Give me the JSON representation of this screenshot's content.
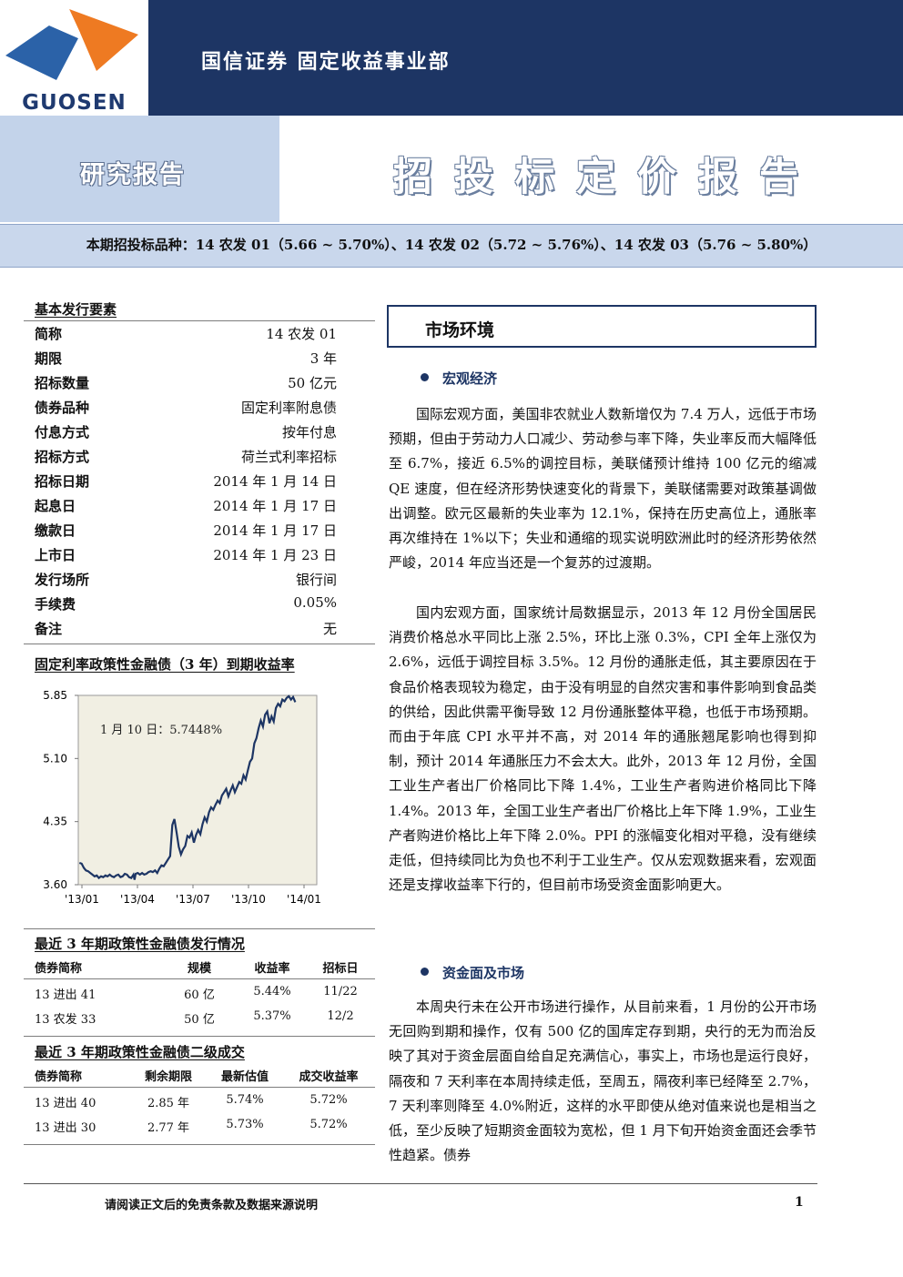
{
  "header": {
    "logo_text": "GUOSEN",
    "company": "国信证券  固定收益事业部",
    "report_type": "研究报告",
    "title": "招投标定价报告",
    "variety": "本期招投标品种：14 农发 01（5.66 ~ 5.70%）、14 农发 02（5.72 ~ 5.76%）、14 农发 03（5.76 ~ 5.80%）",
    "colors": {
      "navy": "#1d3564",
      "light_blue": "#c3d3ea",
      "logo_blue": "#2b62a8",
      "logo_orange": "#ee7a22"
    }
  },
  "basic": {
    "title": "基本发行要素",
    "rows": [
      {
        "key": "简称",
        "value": "14 农发 01"
      },
      {
        "key": "期限",
        "value": "3 年"
      },
      {
        "key": "招标数量",
        "value": "50 亿元"
      },
      {
        "key": "债券品种",
        "value": "固定利率附息债"
      },
      {
        "key": "付息方式",
        "value": "按年付息"
      },
      {
        "key": "招标方式",
        "value": "荷兰式利率招标"
      },
      {
        "key": "招标日期",
        "value": "2014 年 1 月 14 日"
      },
      {
        "key": "起息日",
        "value": "2014 年 1 月 17 日"
      },
      {
        "key": "缴款日",
        "value": "2014 年 1 月 17 日"
      },
      {
        "key": "上市日",
        "value": "2014 年 1 月 23 日"
      },
      {
        "key": "发行场所",
        "value": "银行间"
      },
      {
        "key": "手续费",
        "value": "0.05%"
      },
      {
        "key": "备注",
        "value": "无"
      }
    ]
  },
  "chart_title": "固定利率政策性金融债（3 年）到期收益率",
  "chart_data": {
    "type": "line",
    "annotation": "1 月 10 日：5.7448%",
    "x_ticks": [
      "'13/01",
      "'13/04",
      "'13/07",
      "'13/10",
      "'14/01"
    ],
    "y_ticks": [
      "5.85",
      "5.10",
      "4.35",
      "3.60"
    ],
    "ylim": [
      3.6,
      5.85
    ],
    "grid": false,
    "series": [
      {
        "points": [
          [
            0.0,
            3.86
          ],
          [
            0.01,
            3.85
          ],
          [
            0.02,
            3.8
          ],
          [
            0.03,
            3.77
          ],
          [
            0.04,
            3.76
          ],
          [
            0.05,
            3.74
          ],
          [
            0.06,
            3.72
          ],
          [
            0.07,
            3.7
          ],
          [
            0.08,
            3.71
          ],
          [
            0.09,
            3.68
          ],
          [
            0.1,
            3.7
          ],
          [
            0.11,
            3.69
          ],
          [
            0.12,
            3.71
          ],
          [
            0.13,
            3.7
          ],
          [
            0.14,
            3.72
          ],
          [
            0.15,
            3.7
          ],
          [
            0.16,
            3.69
          ],
          [
            0.17,
            3.71
          ],
          [
            0.18,
            3.72
          ],
          [
            0.19,
            3.69
          ],
          [
            0.2,
            3.7
          ],
          [
            0.21,
            3.73
          ],
          [
            0.22,
            3.72
          ],
          [
            0.23,
            3.69
          ],
          [
            0.24,
            3.68
          ],
          [
            0.25,
            3.72
          ],
          [
            0.255,
            3.66
          ],
          [
            0.26,
            3.73
          ],
          [
            0.27,
            3.74
          ],
          [
            0.28,
            3.72
          ],
          [
            0.29,
            3.74
          ],
          [
            0.3,
            3.72
          ],
          [
            0.31,
            3.73
          ],
          [
            0.32,
            3.75
          ],
          [
            0.33,
            3.76
          ],
          [
            0.34,
            3.75
          ],
          [
            0.35,
            3.77
          ],
          [
            0.36,
            3.74
          ],
          [
            0.37,
            3.79
          ],
          [
            0.38,
            3.83
          ],
          [
            0.39,
            3.82
          ],
          [
            0.4,
            3.86
          ],
          [
            0.41,
            3.9
          ],
          [
            0.42,
            3.94
          ],
          [
            0.43,
            4.31
          ],
          [
            0.44,
            4.38
          ],
          [
            0.45,
            4.22
          ],
          [
            0.46,
            4.05
          ],
          [
            0.47,
            3.96
          ],
          [
            0.48,
            4.02
          ],
          [
            0.49,
            4.06
          ],
          [
            0.5,
            4.18
          ],
          [
            0.51,
            4.16
          ],
          [
            0.52,
            4.22
          ],
          [
            0.53,
            4.1
          ],
          [
            0.54,
            4.19
          ],
          [
            0.55,
            4.25
          ],
          [
            0.56,
            4.2
          ],
          [
            0.57,
            4.32
          ],
          [
            0.58,
            4.4
          ],
          [
            0.59,
            4.35
          ],
          [
            0.6,
            4.46
          ],
          [
            0.61,
            4.52
          ],
          [
            0.62,
            4.49
          ],
          [
            0.63,
            4.55
          ],
          [
            0.64,
            4.6
          ],
          [
            0.65,
            4.57
          ],
          [
            0.66,
            4.66
          ],
          [
            0.67,
            4.7
          ],
          [
            0.68,
            4.74
          ],
          [
            0.69,
            4.65
          ],
          [
            0.7,
            4.72
          ],
          [
            0.71,
            4.78
          ],
          [
            0.72,
            4.7
          ],
          [
            0.73,
            4.76
          ],
          [
            0.74,
            4.82
          ],
          [
            0.75,
            4.8
          ],
          [
            0.76,
            4.9
          ],
          [
            0.77,
            4.85
          ],
          [
            0.78,
            4.96
          ],
          [
            0.79,
            5.06
          ],
          [
            0.8,
            5.1
          ],
          [
            0.81,
            5.28
          ],
          [
            0.82,
            5.34
          ],
          [
            0.83,
            5.46
          ],
          [
            0.84,
            5.55
          ],
          [
            0.85,
            5.48
          ],
          [
            0.86,
            5.62
          ],
          [
            0.87,
            5.66
          ],
          [
            0.88,
            5.52
          ],
          [
            0.89,
            5.6
          ],
          [
            0.9,
            5.54
          ],
          [
            0.91,
            5.7
          ],
          [
            0.92,
            5.75
          ],
          [
            0.93,
            5.72
          ],
          [
            0.94,
            5.8
          ],
          [
            0.95,
            5.78
          ],
          [
            0.96,
            5.82
          ],
          [
            0.97,
            5.84
          ],
          [
            0.98,
            5.8
          ],
          [
            0.99,
            5.83
          ],
          [
            1.0,
            5.77
          ]
        ]
      }
    ],
    "colors": {
      "line": "#1d3564",
      "plot_bg": "#f1efe3"
    }
  },
  "issue_table": {
    "title": "最近 3 年期政策性金融债发行情况",
    "headers": [
      "债券简称",
      "规模",
      "收益率",
      "招标日"
    ],
    "rows": [
      [
        "13 进出 41",
        "60 亿",
        "5.44%",
        "11/22"
      ],
      [
        "13 农发 33",
        "50 亿",
        "5.37%",
        "12/2"
      ]
    ]
  },
  "secondary_table": {
    "title": "最近 3 年期政策性金融债二级成交",
    "headers": [
      "债券简称",
      "剩余期限",
      "最新估值",
      "成交收益率"
    ],
    "rows": [
      [
        "13 进出 40",
        "2.85 年",
        "5.74%",
        "5.72%"
      ],
      [
        "13 进出 30",
        "2.77 年",
        "5.73%",
        "5.72%"
      ]
    ]
  },
  "main": {
    "section_title": "市场环境",
    "macro_title": "宏观经济",
    "macro_p1": "国际宏观方面，美国非农就业人数新增仅为 7.4 万人，远低于市场预期，但由于劳动力人口减少、劳动参与率下降，失业率反而大幅降低至 6.7%，接近 6.5%的调控目标，美联储预计维持 100 亿元的缩减 QE 速度，但在经济形势快速变化的背景下，美联储需要对政策基调做出调整。欧元区最新的失业率为 12.1%，保持在历史高位上，通胀率再次维持在 1%以下；失业和通缩的现实说明欧洲此时的经济形势依然严峻，2014 年应当还是一个复苏的过渡期。",
    "macro_p2": "国内宏观方面，国家统计局数据显示，2013 年 12 月份全国居民消费价格总水平同比上涨 2.5%，环比上涨 0.3%，CPI 全年上涨仅为 2.6%，远低于调控目标 3.5%。12 月份的通胀走低，其主要原因在于食品价格表现较为稳定，由于没有明显的自然灾害和事件影响到食品类的供给，因此供需平衡导致 12 月份通胀整体平稳，也低于市场预期。而由于年底 CPI 水平并不高，对 2014 年的通胀翘尾影响也得到抑制，预计 2014 年通胀压力不会太大。此外，2013 年 12 月份，全国工业生产者出厂价格同比下降 1.4%，工业生产者购进价格同比下降 1.4%。2013 年，全国工业生产者出厂价格比上年下降 1.9%，工业生产者购进价格比上年下降 2.0%。PPI 的涨幅变化相对平稳，没有继续走低，但持续同比为负也不利于工业生产。仅从宏观数据来看，宏观面还是支撑收益率下行的，但目前市场受资金面影响更大。",
    "fund_title": "资金面及市场",
    "fund_p1": "本周央行未在公开市场进行操作，从目前来看，1 月份的公开市场无回购到期和操作，仅有 500 亿的国库定存到期，央行的无为而治反映了其对于资金层面自给自足充满信心，事实上，市场也是运行良好，隔夜和 7 天利率在本周持续走低，至周五，隔夜利率已经降至 2.7%，7 天利率则降至 4.0%附近，这样的水平即使从绝对值来说也是相当之低，至少反映了短期资金面较为宽松，但 1 月下旬开始资金面还会季节性趋紧。债券"
  },
  "footer": {
    "disclaimer": "请阅读正文后的免责条款及数据来源说明",
    "page": "1"
  }
}
